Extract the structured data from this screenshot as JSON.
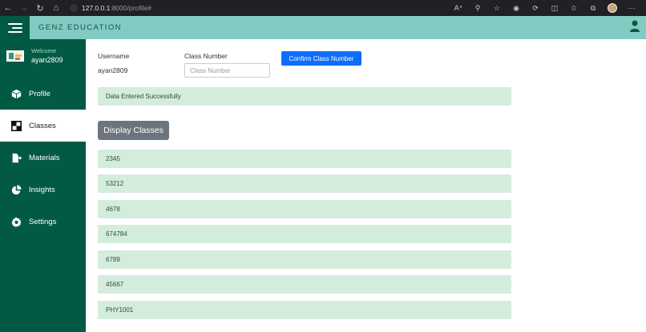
{
  "browser": {
    "url_host": "127.0.0.1",
    "url_path": ":8000/profile#"
  },
  "header": {
    "brand": "GENZ EDUCATION"
  },
  "sidebar": {
    "welcome_label": "Welcome",
    "username": "ayan2809",
    "items": [
      {
        "label": "Profile",
        "icon": "cube-icon"
      },
      {
        "label": "Classes",
        "icon": "checker-icon"
      },
      {
        "label": "Materials",
        "icon": "file-export-icon"
      },
      {
        "label": "Insights",
        "icon": "pie-chart-icon"
      },
      {
        "label": "Settings",
        "icon": "gear-icon"
      }
    ],
    "active_item": "Classes"
  },
  "form": {
    "username_label": "Username",
    "username_value": "ayan2809",
    "class_number_label": "Class Number",
    "class_number_placeholder": "Class Number",
    "confirm_button": "Confirm Class Number"
  },
  "alert": {
    "message": "Data Entered Successfully"
  },
  "display_button": "Display Classes",
  "classes": [
    "2345",
    "53212",
    "4678",
    "674784",
    "6789",
    "45667",
    "PHY1001"
  ],
  "colors": {
    "sidebar": "#035a44",
    "header": "#82cbc2",
    "alert_bg": "#d4ecdc",
    "primary_button": "#0d6efd",
    "secondary_button": "#6c757d"
  }
}
